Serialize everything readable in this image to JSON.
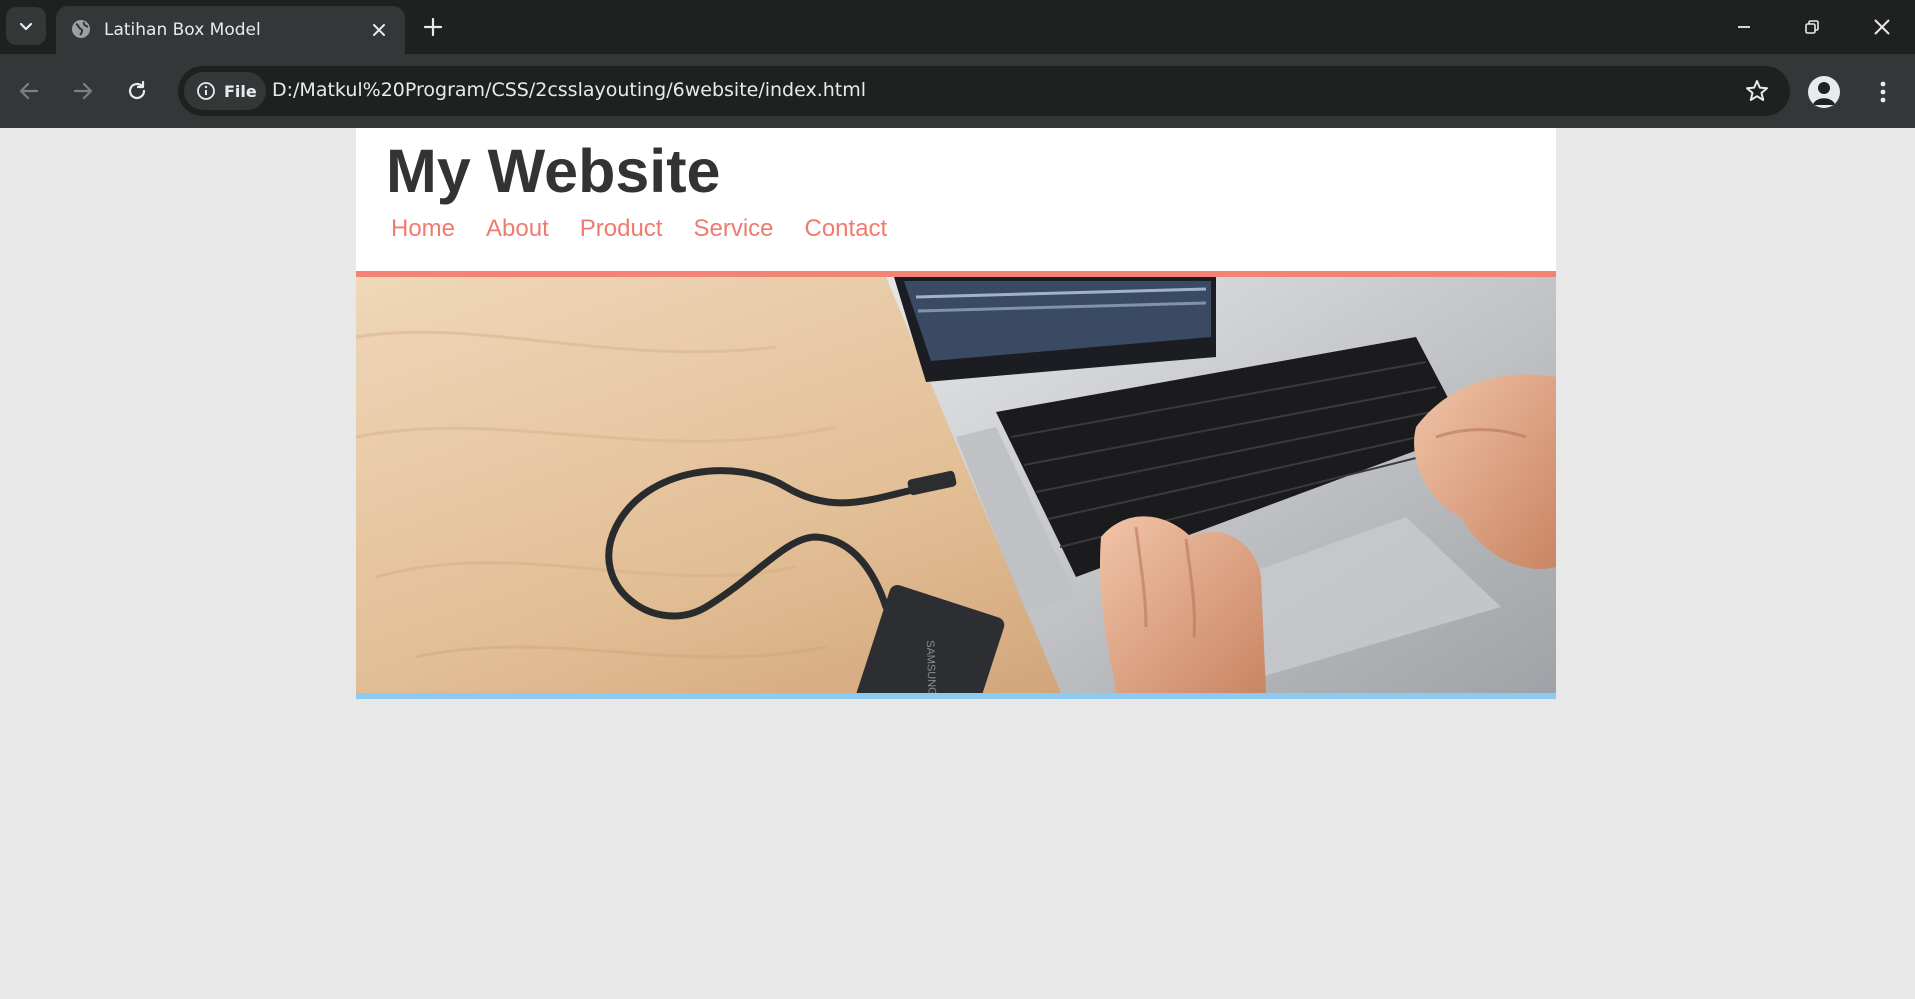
{
  "browser": {
    "tab": {
      "title": "Latihan Box Model"
    },
    "address": {
      "scheme_chip": "File",
      "url": "D:/Matkul%20Program/CSS/2csslayouting/6website/index.html"
    }
  },
  "page": {
    "site_title": "My Website",
    "nav": {
      "items": [
        {
          "label": "Home"
        },
        {
          "label": "About"
        },
        {
          "label": "Product"
        },
        {
          "label": "Service"
        },
        {
          "label": "Contact"
        }
      ]
    },
    "hero": {
      "drive_brand": "SAMSUNG"
    }
  },
  "colors": {
    "nav_link": "#f07a6e",
    "hero_border_top": "#f38375",
    "hero_border_bottom": "#8ccaf1",
    "title": "#333333",
    "page_bg": "#e8e8e8"
  }
}
